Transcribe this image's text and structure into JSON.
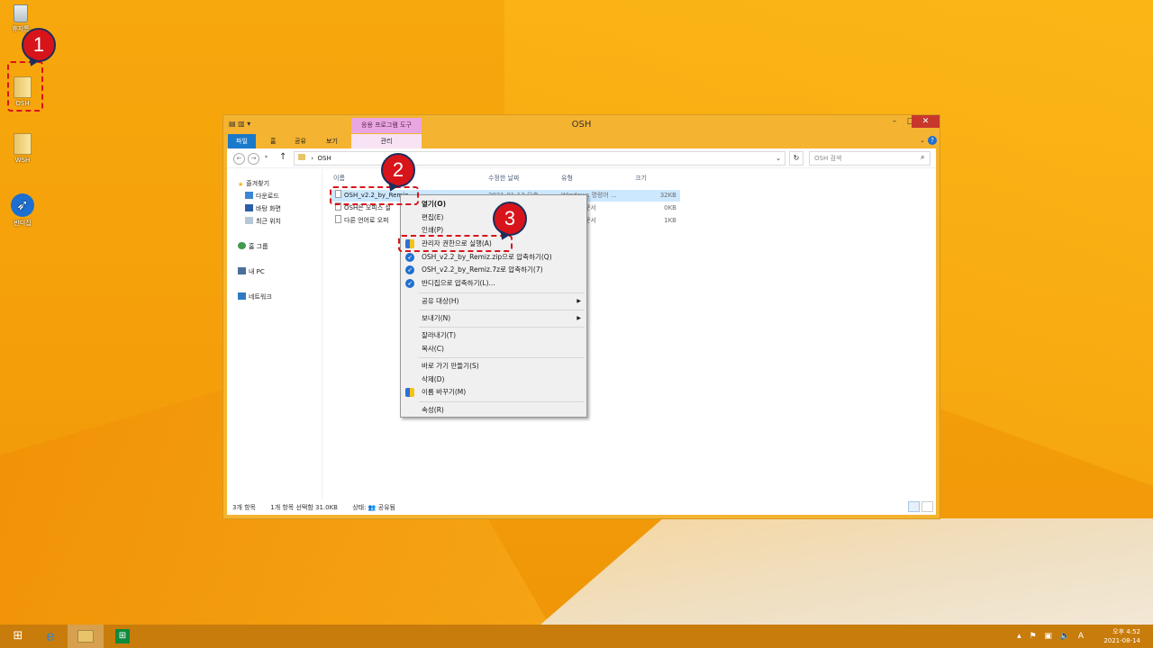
{
  "desktop": {
    "icons": [
      {
        "label": "휴지통"
      },
      {
        "label": "OSH"
      },
      {
        "label": "WSH"
      },
      {
        "label": "반디집"
      }
    ]
  },
  "callouts": [
    "1",
    "2",
    "3"
  ],
  "window": {
    "title": "OSH",
    "context_tab_group": "응용 프로그램 도구",
    "tabs": [
      "파일",
      "홈",
      "공유",
      "보기",
      "관리"
    ],
    "address": "OSH",
    "search_placeholder": "OSH 검색",
    "nav": {
      "favorites": "즐겨찾기",
      "downloads": "다운로드",
      "desktop": "바탕 화면",
      "recent": "최근 위치",
      "homegroup": "홈 그룹",
      "this_pc": "내 PC",
      "network": "네트워크"
    },
    "columns": [
      "이름",
      "수정한 날짜",
      "유형",
      "크기"
    ],
    "files": [
      {
        "name": "OSH_v2.2_by_Remiz",
        "date": "2021-01-13 오후",
        "type": "Windows 명령어 ...",
        "size": "32KB"
      },
      {
        "name": "OSH은 오피스 설",
        "date": "",
        "type": "문서",
        "size": "0KB"
      },
      {
        "name": "다른 언어로 오피",
        "date": "",
        "type": "문서",
        "size": "1KB"
      }
    ],
    "status": {
      "count": "3개 항목",
      "selected": "1개 항목 선택함 31.0KB",
      "state": "상태: 👥 공유됨"
    }
  },
  "context_menu": {
    "items": [
      {
        "label": "열기(O)"
      },
      {
        "label": "편집(E)"
      },
      {
        "label": "인쇄(P)"
      },
      {
        "label": "관리자 권한으로 실행(A)"
      },
      {
        "label": "OSH_v2.2_by_Remiz.zip으로 압축하기(Q)"
      },
      {
        "label": "OSH_v2.2_by_Remiz.7z로 압축하기(7)"
      },
      {
        "label": "반디집으로 압축하기(L)..."
      },
      {
        "label": "공유 대상(H)"
      },
      {
        "label": "보내기(N)"
      },
      {
        "label": "잘라내기(T)"
      },
      {
        "label": "복사(C)"
      },
      {
        "label": "바로 가기 만들기(S)"
      },
      {
        "label": "삭제(D)"
      },
      {
        "label": "이름 바꾸기(M)"
      },
      {
        "label": "속성(R)"
      }
    ]
  },
  "taskbar": {
    "clock_period": "오후 4:52",
    "clock_date": "2021-08-14",
    "ime": "A"
  }
}
